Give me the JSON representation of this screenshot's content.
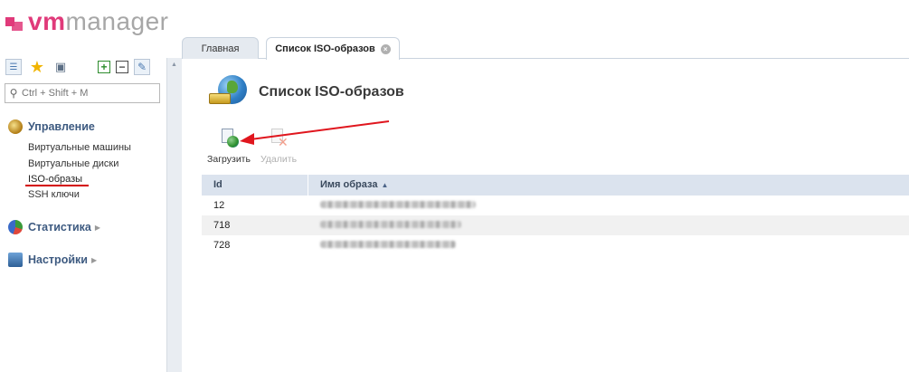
{
  "app": {
    "logo_vm": "vm",
    "logo_manager": "manager",
    "accent": "#e03a7a"
  },
  "sidebar": {
    "search_placeholder": "Ctrl + Shift + M",
    "groups": [
      {
        "label": "Управление",
        "icon": "management-icon",
        "items": [
          "Виртуальные машины",
          "Виртуальные диски",
          "ISO-образы",
          "SSH ключи"
        ]
      },
      {
        "label": "Статистика",
        "icon": "statistics-icon"
      },
      {
        "label": "Настройки",
        "icon": "settings-icon"
      }
    ],
    "active_item": "ISO-образы"
  },
  "tabs": [
    {
      "label": "Главная"
    },
    {
      "label": "Список ISO-образов"
    }
  ],
  "page": {
    "title": "Список ISO-образов",
    "actions": {
      "upload": "Загрузить",
      "delete": "Удалить"
    }
  },
  "table": {
    "columns": [
      "Id",
      "Имя образа"
    ],
    "rows": [
      {
        "id": "12"
      },
      {
        "id": "718"
      },
      {
        "id": "728"
      }
    ]
  }
}
